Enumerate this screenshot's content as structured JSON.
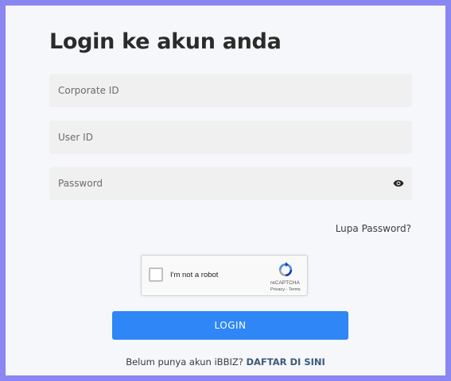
{
  "form": {
    "title": "Login ke akun anda",
    "corporate_id": {
      "placeholder": "Corporate ID",
      "value": ""
    },
    "user_id": {
      "placeholder": "User ID",
      "value": ""
    },
    "password": {
      "placeholder": "Password",
      "value": ""
    },
    "show_password_icon": "eye-icon",
    "forgot_password_label": "Lupa Password?",
    "login_label": "LOGIN"
  },
  "captcha": {
    "label": "I'm not a robot",
    "brand": "reCAPTCHA",
    "privacy": "Privacy",
    "separator": " - ",
    "terms": "Terms",
    "checked": false
  },
  "signup": {
    "prompt": "Belum punya akun iBBIZ?",
    "link_label": "DAFTAR DI SINI"
  },
  "colors": {
    "frame": "#8a86f2",
    "background": "#f5f7fa",
    "input_bg": "#f0f0f0",
    "primary_button": "#2f86f6",
    "link": "#3d5a78"
  }
}
